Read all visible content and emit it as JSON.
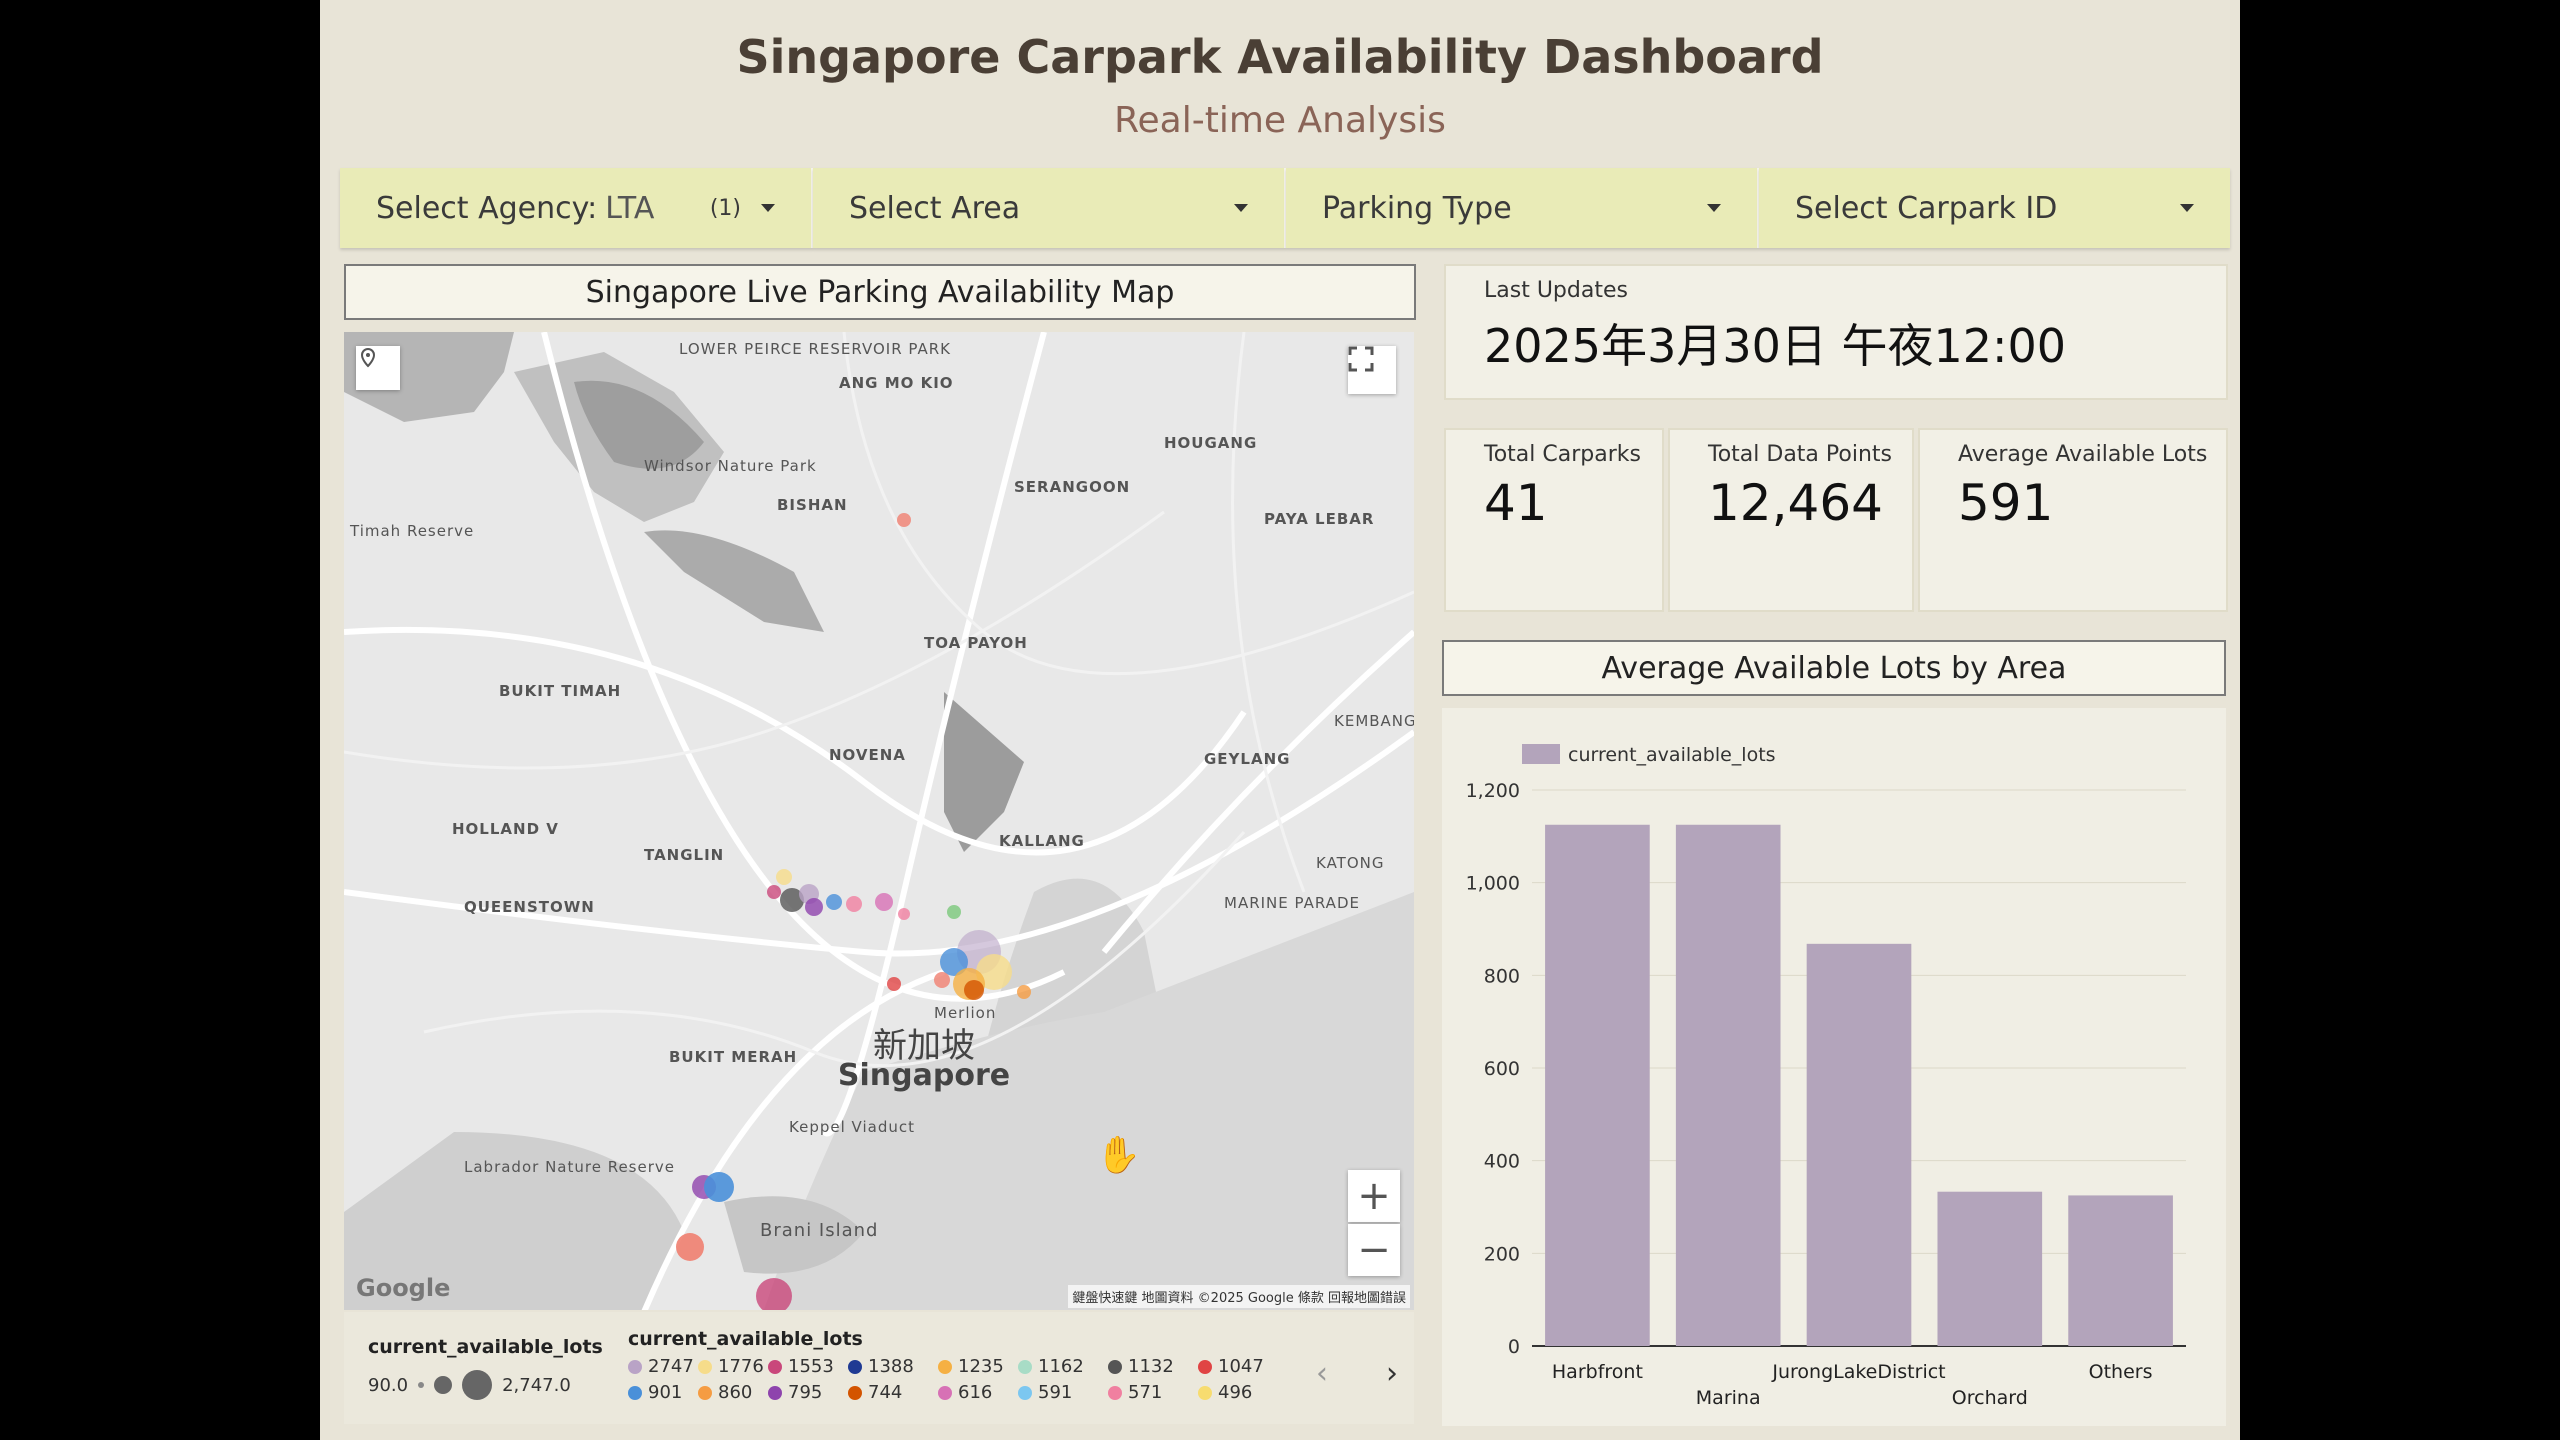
{
  "dashboard": {
    "title": "Singapore Carpark Availability Dashboard",
    "subtitle": "Real-time Analysis"
  },
  "filters": [
    {
      "label": "Select Agency:",
      "value": "LTA",
      "count": "(1)"
    },
    {
      "label": "Select Area",
      "value": "",
      "count": ""
    },
    {
      "label": "Parking Type",
      "value": "",
      "count": ""
    },
    {
      "label": "Select Carpark ID",
      "value": "",
      "count": ""
    }
  ],
  "map": {
    "title": "Singapore Live Parking Availability Map",
    "center_label_zh": "新加坡",
    "center_label_en": "Singapore",
    "labels": [
      "Lower Peirce Reservoir Park",
      "ANG MO KIO",
      "HOUGANG",
      "SERANGOON",
      "BISHAN",
      "PAYA LEBAR",
      "Windsor Nature Park",
      "TOA PAYOH",
      "BUKIT TIMAH",
      "NOVENA",
      "GEYLANG",
      "KEMBANGAN",
      "HOLLAND V",
      "TANGLIN",
      "KALLANG",
      "KATONG",
      "MARINE PARADE",
      "QUEENSTOWN",
      "BUKIT MERAH",
      "Keppel Viaduct",
      "Labrador Nature Reserve",
      "Brani Island",
      "Merlion",
      "Timah Reserve"
    ],
    "footer": "鍵盤快速鍵   地圖資料 ©2025 Google   條款   回報地圖錯誤",
    "google_logo": "Google",
    "zoom_in": "+",
    "zoom_out": "−"
  },
  "legend": {
    "size_title": "current_available_lots",
    "size_min": "90.0",
    "size_max": "2,747.0",
    "color_title": "current_available_lots",
    "items": [
      {
        "label": "2747",
        "color": "#b9a3c6"
      },
      {
        "label": "1776",
        "color": "#f6dc8a"
      },
      {
        "label": "1553",
        "color": "#c9477b"
      },
      {
        "label": "1388",
        "color": "#1f3a93"
      },
      {
        "label": "1235",
        "color": "#f5b043"
      },
      {
        "label": "1162",
        "color": "#a8dcc6"
      },
      {
        "label": "1132",
        "color": "#555555"
      },
      {
        "label": "1047",
        "color": "#e04444"
      },
      {
        "label": "901",
        "color": "#4a90d9"
      },
      {
        "label": "860",
        "color": "#f59c42"
      },
      {
        "label": "795",
        "color": "#8e44ad"
      },
      {
        "label": "744",
        "color": "#d35400"
      },
      {
        "label": "616",
        "color": "#d771b5"
      },
      {
        "label": "591",
        "color": "#7cc7f0"
      },
      {
        "label": "571",
        "color": "#f080a0"
      },
      {
        "label": "496",
        "color": "#f7dc6f"
      }
    ]
  },
  "kpis": {
    "last_updates_label": "Last Updates",
    "last_updates_value": "2025年3月30日 午夜12:00",
    "total_carparks_label": "Total Carparks",
    "total_carparks_value": "41",
    "total_data_points_label": "Total Data Points",
    "total_data_points_value": "12,464",
    "avg_available_label": "Average Available Lots",
    "avg_available_value": "591"
  },
  "chart_data": {
    "type": "bar",
    "title": "Average Available Lots by Area",
    "categories": [
      "Harbfront",
      "Marina",
      "JurongLakeDistrict",
      "Orchard",
      "Others"
    ],
    "series": [
      {
        "name": "current_available_lots",
        "values": [
          1125,
          1125,
          868,
          333,
          325
        ]
      }
    ],
    "ylim": [
      0,
      1200
    ],
    "yticks": [
      "0",
      "200",
      "400",
      "600",
      "800",
      "1,000",
      "1,200"
    ],
    "grid": true,
    "legend": "top-left",
    "color": "#b3a4bb"
  }
}
